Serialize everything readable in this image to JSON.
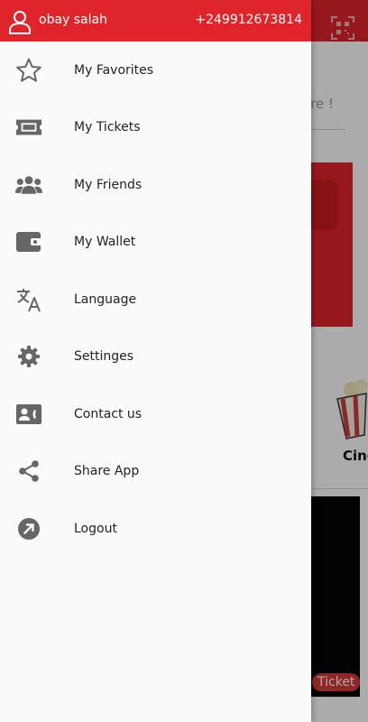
{
  "drawer": {
    "header": {
      "user_name": "obay salah",
      "phone": "+249912673814",
      "avatar_icon": "user-icon",
      "color": "#e0242b"
    },
    "menu_items": [
      {
        "label": "My Favorites",
        "icon": "star-icon"
      },
      {
        "label": "My Tickets",
        "icon": "ticket-icon"
      },
      {
        "label": "My Friends",
        "icon": "group-icon"
      },
      {
        "label": "My Wallet",
        "icon": "wallet-icon"
      },
      {
        "label": "Language",
        "icon": "translate-icon"
      },
      {
        "label": "Settinges",
        "icon": "gear-icon"
      },
      {
        "label": "Contact us",
        "icon": "contact-card-icon"
      },
      {
        "label": "Share App",
        "icon": "share-icon"
      },
      {
        "label": "Logout",
        "icon": "logout-icon"
      }
    ]
  },
  "background": {
    "more_text": "ore !",
    "cinema_label": "Cine",
    "ticket_button": "Ticket",
    "qr_icon": "qr-code-icon"
  }
}
